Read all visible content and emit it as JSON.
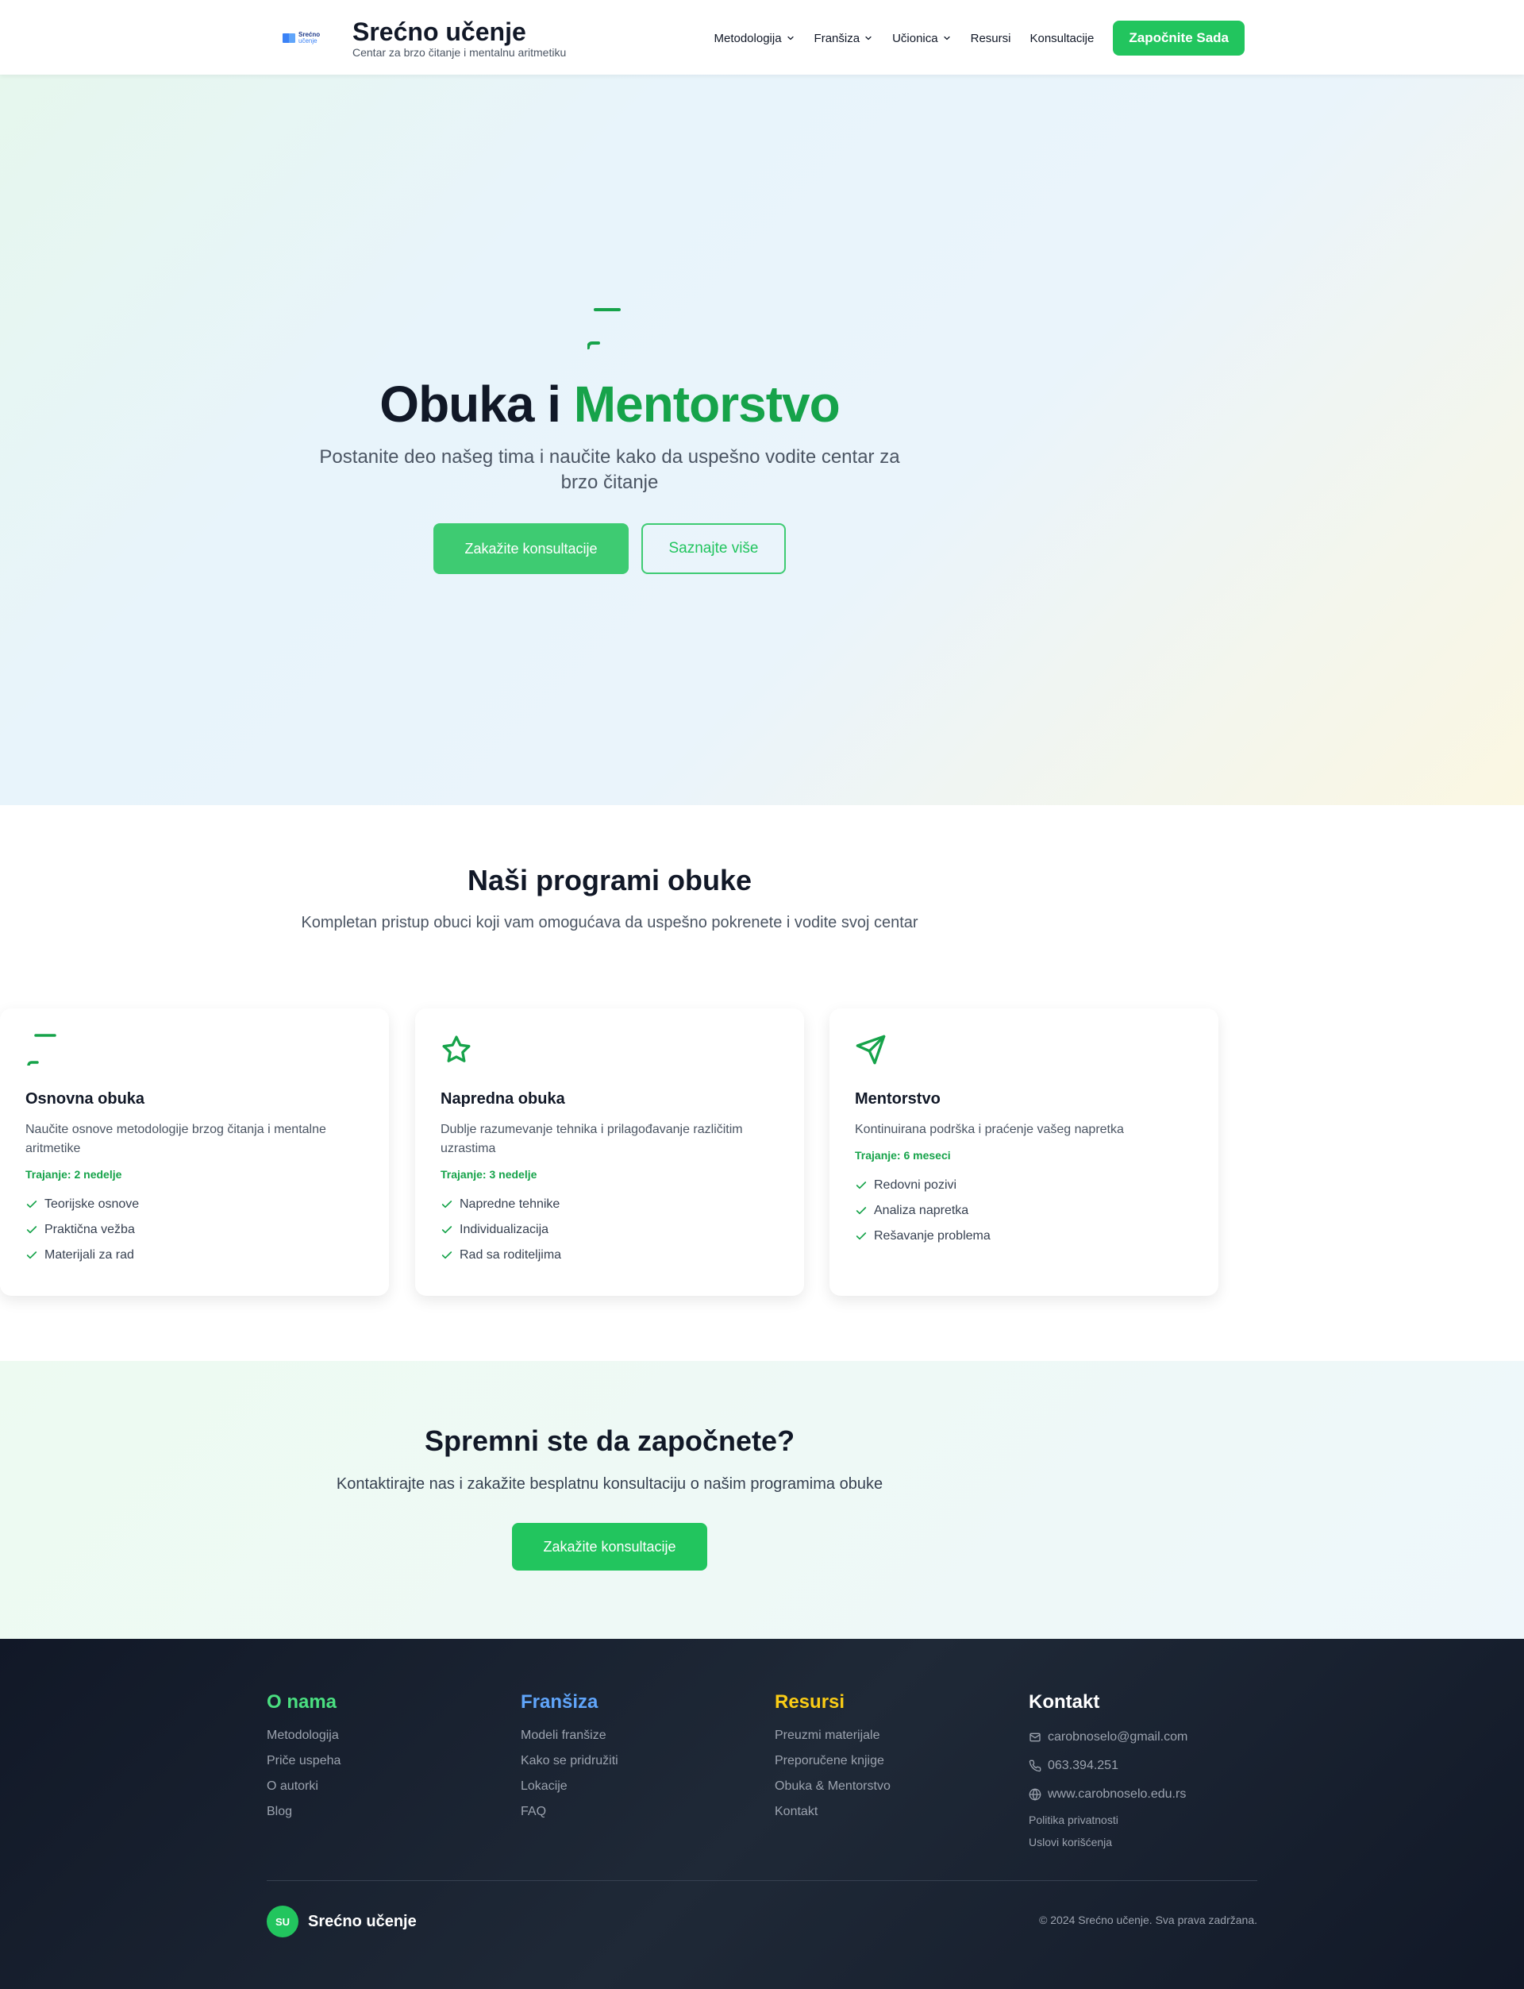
{
  "header": {
    "logo_line1": "Srećno",
    "logo_line2": "učenje",
    "title": "Srećno učenje",
    "subtitle": "Centar za brzo čitanje i mentalnu aritmetiku",
    "nav": [
      {
        "label": "Metodologija",
        "icon": "chevron-down-icon"
      },
      {
        "label": "Franšiza",
        "icon": "chevron-down-icon"
      },
      {
        "label": "Učionica",
        "icon": "chevron-down-icon"
      },
      {
        "label": "Resursi"
      },
      {
        "label": "Konsultacije"
      }
    ],
    "cta_label": "Započnite Sada"
  },
  "hero": {
    "icon": "book-open-icon",
    "title_part1": "Obuka i ",
    "title_accent": "Mentorstvo",
    "subtitle": "Postanite deo našeg tima i naučite kako da uspešno vodite centar za brzo čitanje",
    "primary_button": "Zakažite konsultacije",
    "secondary_button": "Saznajte više"
  },
  "programs": {
    "title": "Naši programi obuke",
    "subtitle": "Kompletan pristup obuci koji vam omogućava da uspešno pokrenete i vodite svoj centar",
    "cards": [
      {
        "icon": "book-open-icon",
        "title": "Osnovna obuka",
        "description": "Naučite osnove metodologije brzog čitanja i mentalne aritmetike",
        "duration": "Trajanje: 2 nedelje",
        "items": [
          "Teorijske osnove",
          "Praktična vežba",
          "Materijali za rad"
        ]
      },
      {
        "icon": "star-icon",
        "title": "Napredna obuka",
        "description": "Dublje razumevanje tehnika i prilagođavanje različitim uzrastima",
        "duration": "Trajanje: 3 nedelje",
        "items": [
          "Napredne tehnike",
          "Individualizacija",
          "Rad sa roditeljima"
        ]
      },
      {
        "icon": "send-icon",
        "title": "Mentorstvo",
        "description": "Kontinuirana podrška i praćenje vašeg napretka",
        "duration": "Trajanje: 6 meseci",
        "items": [
          "Redovni pozivi",
          "Analiza napretka",
          "Rešavanje problema"
        ]
      }
    ]
  },
  "cta": {
    "title": "Spremni ste da započnete?",
    "subtitle": "Kontaktirajte nas i zakažite besplatnu konsultaciju o našim programima obuke",
    "button": "Zakažite konsultacije"
  },
  "footer": {
    "columns": [
      {
        "title": "O nama",
        "color": "#4ade80",
        "links": [
          "Metodologija",
          "Priče uspeha",
          "O autorki",
          "Blog"
        ]
      },
      {
        "title": "Franšiza",
        "color": "#60a5fa",
        "links": [
          "Modeli franšize",
          "Kako se pridružiti",
          "Lokacije",
          "FAQ"
        ]
      },
      {
        "title": "Resursi",
        "color": "#facc15",
        "links": [
          "Preuzmi materijale",
          "Preporučene knjige",
          "Obuka & Mentorstvo",
          "Kontakt"
        ]
      }
    ],
    "contact": {
      "title": "Kontakt",
      "email": "carobnoselo@gmail.com",
      "phone": "063.394.251",
      "website": "www.carobnoselo.edu.rs",
      "privacy": "Politika privatnosti",
      "terms": "Uslovi korišćenja"
    },
    "badge": "SU",
    "brand": "Srećno učenje",
    "copyright": "© 2024 Srećno učenje. Sva prava zadržana."
  },
  "colors": {
    "accent": "#22c55e",
    "accent_dark": "#16a34a",
    "footer_bg": "#111827"
  }
}
